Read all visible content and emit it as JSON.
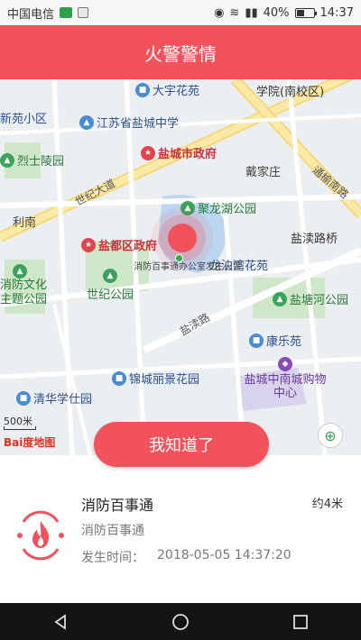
{
  "status_bar": {
    "carrier": "中国电信",
    "battery": "40%",
    "time": "14:37"
  },
  "header": {
    "title": "火警警情"
  },
  "map": {
    "pois": [
      {
        "name": "大宇花苑",
        "kind": "blue"
      },
      {
        "name": "学院(南校区)",
        "kind": "plain"
      },
      {
        "name": "新苑小区",
        "kind": "blue"
      },
      {
        "name": "江苏省盐城中学",
        "kind": "blue"
      },
      {
        "name": "盐城市政府",
        "kind": "red"
      },
      {
        "name": "烈士陵园",
        "kind": "green"
      },
      {
        "name": "戴家庄",
        "kind": "plain"
      },
      {
        "name": "聚龙湖公园",
        "kind": "green"
      },
      {
        "name": "盐都区政府",
        "kind": "red"
      },
      {
        "name": "龙泊湾花苑",
        "kind": "blue"
      },
      {
        "name": "盐渎路桥",
        "kind": "plain"
      },
      {
        "name": "消防文化主题公园",
        "kind": "green"
      },
      {
        "name": "世纪公园",
        "kind": "green"
      },
      {
        "name": "盐塘河公园",
        "kind": "green"
      },
      {
        "name": "康乐苑",
        "kind": "blue"
      },
      {
        "name": "锦城丽景花园",
        "kind": "blue"
      },
      {
        "name": "清华学仕园",
        "kind": "blue"
      },
      {
        "name": "盐城中南城购物中心",
        "kind": "purple"
      },
      {
        "name": "利南",
        "kind": "plain"
      }
    ],
    "roads": [
      "世纪大道",
      "通榆南路",
      "盐渎路"
    ],
    "marker_label": "消防百事通办公室发生火警",
    "scale": "500米",
    "logo": "Bai度地图"
  },
  "ack_button": "我知道了",
  "info": {
    "title": "消防百事通",
    "subtitle": "消防百事通",
    "distance": "约4米",
    "time_label": "发生时间：",
    "time_value": "2018-05-05 14:37:20"
  },
  "colors": {
    "accent": "#f2525b",
    "nav": "#141414"
  },
  "icons": [
    "signal-icon",
    "wifi-icon",
    "battery-icon",
    "fire-alarm-icon",
    "back-icon",
    "home-icon",
    "recent-icon",
    "locate-icon"
  ]
}
